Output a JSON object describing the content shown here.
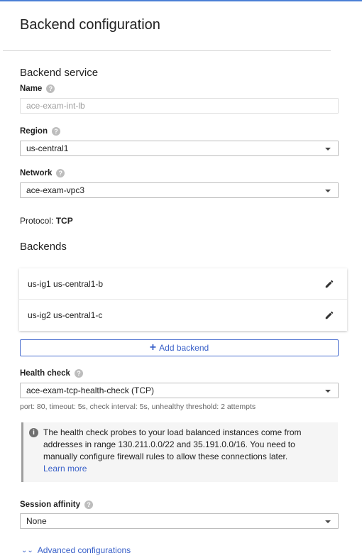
{
  "page": {
    "title": "Backend configuration"
  },
  "backend_service": {
    "section_title": "Backend service",
    "name": {
      "label": "Name",
      "value": "ace-exam-int-lb"
    },
    "region": {
      "label": "Region",
      "value": "us-central1"
    },
    "network": {
      "label": "Network",
      "value": "ace-exam-vpc3"
    },
    "protocol": {
      "label": "Protocol:",
      "value": "TCP"
    }
  },
  "backends": {
    "section_title": "Backends",
    "items": [
      {
        "label": "us-ig1 us-central1-b"
      },
      {
        "label": "us-ig2 us-central1-c"
      }
    ],
    "add_button_label": "Add backend"
  },
  "health_check": {
    "label": "Health check",
    "value": "ace-exam-tcp-health-check (TCP)",
    "details": "port: 80, timeout: 5s, check interval: 5s, unhealthy threshold: 2 attempts",
    "info_text": "The health check probes to your load balanced instances come from addresses in range 130.211.0.0/22 and 35.191.0.0/16. You need to manually configure firewall rules to allow these connections later.",
    "learn_more_label": "Learn more"
  },
  "session_affinity": {
    "label": "Session affinity",
    "value": "None"
  },
  "advanced": {
    "label": "Advanced configurations"
  },
  "colors": {
    "accent": "#3a61c9",
    "top_border": "#4a7fd6",
    "info_border": "#9e9e9e"
  },
  "icons": [
    "help-icon",
    "dropdown-caret-icon",
    "edit-pencil-icon",
    "plus-icon",
    "info-icon",
    "double-chevron-down-icon"
  ]
}
